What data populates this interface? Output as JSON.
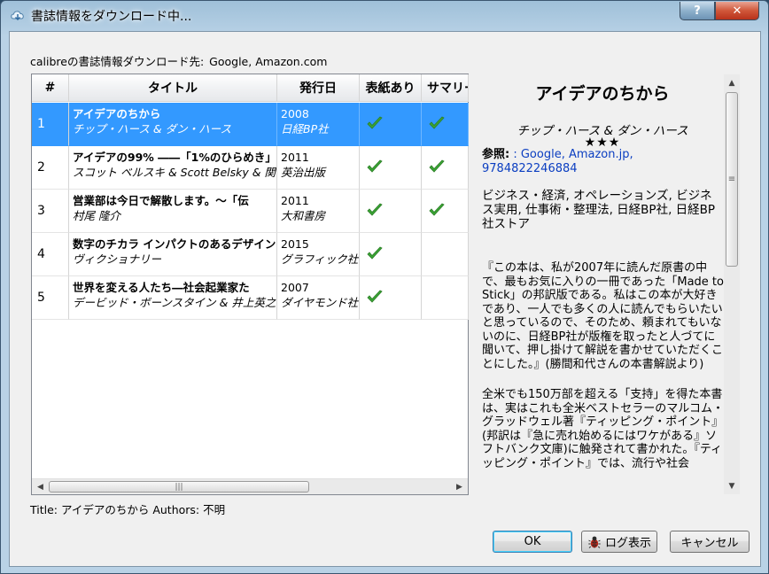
{
  "window": {
    "title": "書誌情報をダウンロード中...",
    "help_label": "?",
    "close_label": "✕"
  },
  "source": {
    "label": "calibreの書誌情報ダウンロード先:",
    "value": "Google, Amazon.com"
  },
  "table": {
    "columns": [
      "#",
      "タイトル",
      "発行日",
      "表紙あり",
      "サマリー"
    ],
    "rows": [
      {
        "num": "1",
        "title": "アイデアのちから",
        "authors": "チップ・ハース & ダン・ハース",
        "year": "2008",
        "publisher": "日経BP社",
        "cover": true,
        "summary": true,
        "selected": true
      },
      {
        "num": "2",
        "title": "アイデアの99% ――「1%のひらめき」",
        "authors": "スコット ベルスキ & Scott Belsky & 関",
        "year": "2011",
        "publisher": "英治出版",
        "cover": true,
        "summary": true,
        "selected": false
      },
      {
        "num": "3",
        "title": "営業部は今日で解散します。～「伝",
        "authors": "村尾 隆介",
        "year": "2011",
        "publisher": "大和書房",
        "cover": true,
        "summary": true,
        "selected": false
      },
      {
        "num": "4",
        "title": "数字のチカラ インパクトのあるデザイン",
        "authors": "ヴィクショナリー",
        "year": "2015",
        "publisher": "グラフィック社",
        "cover": true,
        "summary": false,
        "selected": false
      },
      {
        "num": "5",
        "title": "世界を変える人たち―社会起業家た",
        "authors": "デービッド・ボーンスタイン & 井上英之 &",
        "year": "2007",
        "publisher": "ダイヤモンド社",
        "cover": true,
        "summary": false,
        "selected": false
      }
    ],
    "scroll_thumb_grip": "|||"
  },
  "details": {
    "title": "アイデアのちから",
    "authors": "チップ・ハース & ダン・ハース",
    "rating": "★★★",
    "ref_label": "参照:",
    "ref_links": ": Google, Amazon.jp, 9784822246884",
    "tags": "ビジネス・経済, オペレーションズ, ビジネス実用, 仕事術・整理法, 日経BP社, 日経BP社ストア",
    "comment_paragraphs": [
      "『この本は、私が2007年に読んだ原書の中で、最もお気に入りの一冊であった「Made to Stick」の邦訳版である。私はこの本が大好きであり、一人でも多くの人に読んでもらいたいと思っているので、そのため、頼まれてもいないのに、日経BP社が版権を取ったと人づてに聞いて、押し掛けて解説を書かせていただくことにした。』(勝間和代さんの本書解説より)",
      "全米でも150万部を超える「支持」を得た本書は、実はこれも全米ベストセラーのマルコム・グラッドウェル著『ティッピング・ポイント』(邦訳は『急に売れ始めるにはワケがある』ソフトバンク文庫)に触発されて書かれた。『ティッピング・ポイント』では、流行や社会"
    ],
    "scroll_thumb_grip": "≡"
  },
  "status": {
    "text": "Title: アイデアのちから Authors: 不明"
  },
  "buttons": {
    "ok": "OK",
    "log": "ログ表示",
    "cancel": "キャンセル"
  },
  "colors": {
    "selection": "#3399ff",
    "check": "#3aa534",
    "link": "#0b3ec1"
  }
}
